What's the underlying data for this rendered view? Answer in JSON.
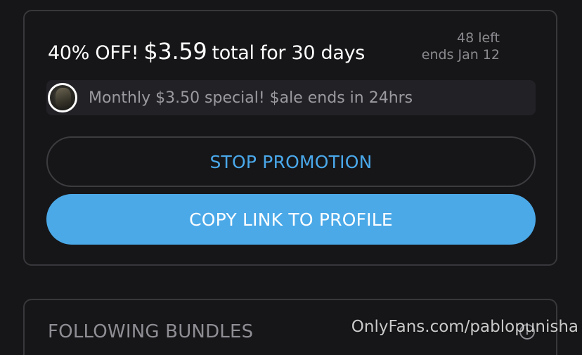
{
  "promotion": {
    "prefix": "40% OFF!",
    "price": "$3.59",
    "suffix": "total for 30 days",
    "left_count": "48 left",
    "ends": "ends Jan 12",
    "message": "Monthly $3.50 special! $ale ends in 24hrs",
    "stop_label": "STOP PROMOTION",
    "copy_label": "COPY LINK TO PROFILE"
  },
  "bundles": {
    "title": "FOLLOWING BUNDLES",
    "info_icon": "i"
  },
  "watermark": "OnlyFans.com/pablopunisha",
  "colors": {
    "background": "#161618",
    "accent": "#4ba9e8",
    "muted_text": "#8a8a8f",
    "card_border": "#38383c"
  },
  "icons": {
    "avatar": "avatar",
    "info": "info-icon"
  }
}
